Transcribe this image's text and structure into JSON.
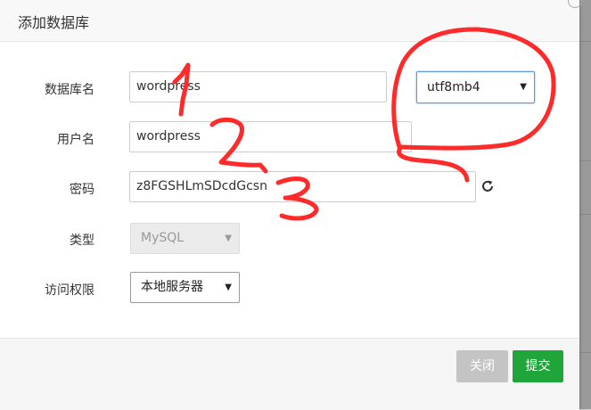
{
  "dialog": {
    "title": "添加数据库"
  },
  "form": {
    "db_name_label": "数据库名",
    "db_name_value": "wordpress",
    "charset_value": "utf8mb4",
    "username_label": "用户名",
    "username_value": "wordpress",
    "password_label": "密码",
    "password_value": "z8FGSHLmSDcdGcsn",
    "type_label": "类型",
    "type_value": "MySQL",
    "access_label": "访问权限",
    "access_value": "本地服务器"
  },
  "footer": {
    "close_label": "关闭",
    "submit_label": "提交"
  },
  "colors": {
    "submit": "#20a53a",
    "close": "#c4c4c4",
    "annotation": "#ff2a2a",
    "focus": "#5b9bd5"
  },
  "icons": {
    "refresh": "refresh-icon",
    "select_caret": "caret-down-icon"
  },
  "annotations": {
    "handwritten_numbers": [
      "1",
      "2",
      "3"
    ]
  }
}
